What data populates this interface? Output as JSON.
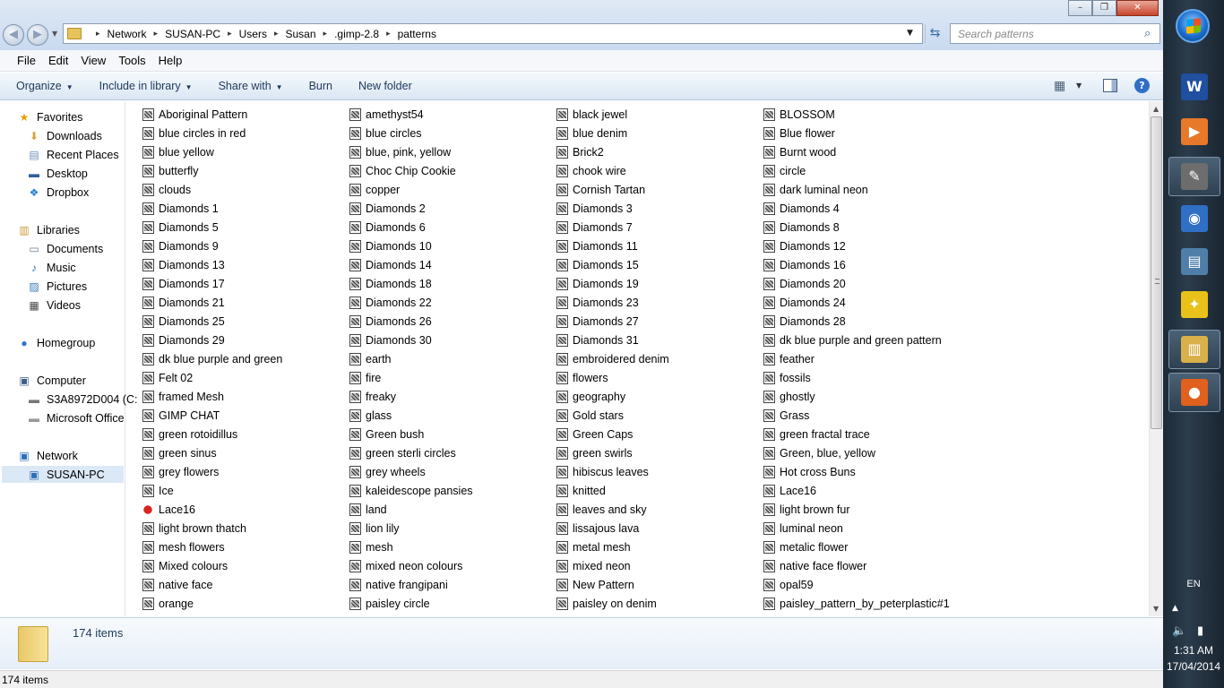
{
  "window": {
    "caption_buttons": [
      "–",
      "❐",
      "✕"
    ]
  },
  "address": {
    "crumbs": [
      "Network",
      "SUSAN-PC",
      "Users",
      "Susan",
      ".gimp-2.8",
      "patterns"
    ]
  },
  "search": {
    "placeholder": "Search patterns"
  },
  "menu": [
    "File",
    "Edit",
    "View",
    "Tools",
    "Help"
  ],
  "commands": [
    {
      "label": "Organize",
      "dropdown": true
    },
    {
      "label": "Include in library",
      "dropdown": true
    },
    {
      "label": "Share with",
      "dropdown": true
    },
    {
      "label": "Burn",
      "dropdown": false
    },
    {
      "label": "New folder",
      "dropdown": false
    }
  ],
  "nav": [
    {
      "label": "Favorites",
      "icon": "star-icon",
      "glyph": "★",
      "color": "#e6a100",
      "indent": 0,
      "group": true
    },
    {
      "label": "Downloads",
      "icon": "downloads-icon",
      "glyph": "⬇",
      "color": "#d6a23a",
      "indent": 1
    },
    {
      "label": "Recent Places",
      "icon": "recent-places-icon",
      "glyph": "▤",
      "color": "#6b8fb8",
      "indent": 1
    },
    {
      "label": "Desktop",
      "icon": "desktop-icon",
      "glyph": "▬",
      "color": "#2f5f9c",
      "indent": 1
    },
    {
      "label": "Dropbox",
      "icon": "dropbox-icon",
      "glyph": "❖",
      "color": "#1f7fd8",
      "indent": 1
    },
    {
      "label": "Libraries",
      "icon": "libraries-icon",
      "glyph": "▥",
      "color": "#c99a3b",
      "indent": 0,
      "group": true
    },
    {
      "label": "Documents",
      "icon": "documents-icon",
      "glyph": "▭",
      "color": "#6d7c8e",
      "indent": 1
    },
    {
      "label": "Music",
      "icon": "music-icon",
      "glyph": "♪",
      "color": "#2f6fc4",
      "indent": 1
    },
    {
      "label": "Pictures",
      "icon": "pictures-icon",
      "glyph": "▨",
      "color": "#3a7dbb",
      "indent": 1
    },
    {
      "label": "Videos",
      "icon": "videos-icon",
      "glyph": "▦",
      "color": "#444",
      "indent": 1
    },
    {
      "label": "Homegroup",
      "icon": "homegroup-icon",
      "glyph": "●",
      "color": "#2d74c9",
      "indent": 0,
      "group": true
    },
    {
      "label": "Computer",
      "icon": "computer-icon",
      "glyph": "▣",
      "color": "#3d5f86",
      "indent": 0,
      "group": true
    },
    {
      "label": "S3A8972D004 (C:",
      "icon": "drive-c-icon",
      "glyph": "▬",
      "color": "#777",
      "indent": 1
    },
    {
      "label": "Microsoft Office",
      "icon": "drive-office-icon",
      "glyph": "▬",
      "color": "#999",
      "indent": 1
    },
    {
      "label": "Network",
      "icon": "network-icon",
      "glyph": "▣",
      "color": "#2d6fb8",
      "indent": 0,
      "group": true
    },
    {
      "label": "SUSAN-PC",
      "icon": "pc-icon",
      "glyph": "▣",
      "color": "#2d6fb8",
      "indent": 1,
      "selected": true
    }
  ],
  "files": {
    "columns": [
      [
        "Aboriginal Pattern",
        "blue  circles in red",
        "blue yellow",
        "butterfly",
        "clouds",
        "Diamonds 1",
        "Diamonds 5",
        "Diamonds 9",
        "Diamonds 13",
        "Diamonds 17",
        "Diamonds 21",
        "Diamonds 25",
        "Diamonds 29",
        "dk blue purple and green",
        "Felt 02",
        "framed Mesh",
        "GIMP CHAT",
        "green  rotoidillus",
        "green sinus",
        "grey flowers",
        "Ice",
        "Lace16",
        "light brown thatch",
        "mesh flowers",
        "Mixed colours",
        "native face",
        "orange"
      ],
      [
        "amethyst54",
        "blue  circles",
        "blue, pink, yellow",
        "Choc Chip Cookie",
        "copper",
        "Diamonds 2",
        "Diamonds 6",
        "Diamonds 10",
        "Diamonds 14",
        "Diamonds 18",
        "Diamonds 22",
        "Diamonds 26",
        "Diamonds 30",
        "earth",
        "fire",
        "freaky",
        "glass",
        "Green bush",
        "green sterli circles",
        "grey wheels",
        "kaleidescope pansies",
        "land",
        "lion lily",
        "mesh",
        "mixed neon colours",
        "native frangipani",
        "paisley circle"
      ],
      [
        "black jewel",
        "blue denim",
        "Brick2",
        "chook wire",
        "Cornish Tartan",
        "Diamonds 3",
        "Diamonds 7",
        "Diamonds 11",
        "Diamonds 15",
        "Diamonds 19",
        "Diamonds 23",
        "Diamonds 27",
        "Diamonds 31",
        "embroidered denim",
        "flowers",
        "geography",
        "Gold stars",
        "Green Caps",
        "green swirls",
        "hibiscus leaves",
        "knitted",
        "leaves and sky",
        "lissajous lava",
        "metal mesh",
        "mixed neon",
        "New Pattern",
        "paisley on denim"
      ],
      [
        "BLOSSOM",
        "Blue flower",
        "Burnt wood",
        "circle",
        "dark luminal neon",
        "Diamonds 4",
        "Diamonds 8",
        "Diamonds 12",
        "Diamonds 16",
        "Diamonds 20",
        "Diamonds 24",
        "Diamonds 28",
        "dk blue purple and green pattern",
        "feather",
        "fossils",
        "ghostly",
        "Grass",
        "green fractal trace",
        "Green, blue, yellow",
        "Hot cross Buns",
        "Lace16",
        "light brown fur",
        "luminal neon",
        "metalic flower",
        "native face flower",
        "opal59",
        "paisley_pattern_by_peterplastic#1"
      ]
    ],
    "red_icon_item": "Lace16"
  },
  "details": {
    "count": "174 items"
  },
  "status": {
    "count": "174 items"
  },
  "taskbar": {
    "apps": [
      {
        "name": "word-icon",
        "glyph": "W",
        "bg": "#1f4f9e",
        "active": false
      },
      {
        "name": "media-player-icon",
        "glyph": "▶",
        "bg": "#e8782a",
        "active": false
      },
      {
        "name": "gimp-icon",
        "glyph": "✎",
        "bg": "#6d6d6d",
        "active": true
      },
      {
        "name": "camera-icon",
        "glyph": "◉",
        "bg": "#2f6fc4",
        "active": false
      },
      {
        "name": "document-app-icon",
        "glyph": "▤",
        "bg": "#4f7fa8",
        "active": false
      },
      {
        "name": "puzzle-app-icon",
        "glyph": "✦",
        "bg": "#e8c21a",
        "active": false
      },
      {
        "name": "explorer-icon",
        "glyph": "▥",
        "bg": "#d9b04a",
        "active": true
      },
      {
        "name": "firefox-icon",
        "glyph": "●",
        "bg": "#e0601e",
        "active": true
      }
    ],
    "language": "EN",
    "time": "1:31 AM",
    "date": "17/04/2014"
  }
}
